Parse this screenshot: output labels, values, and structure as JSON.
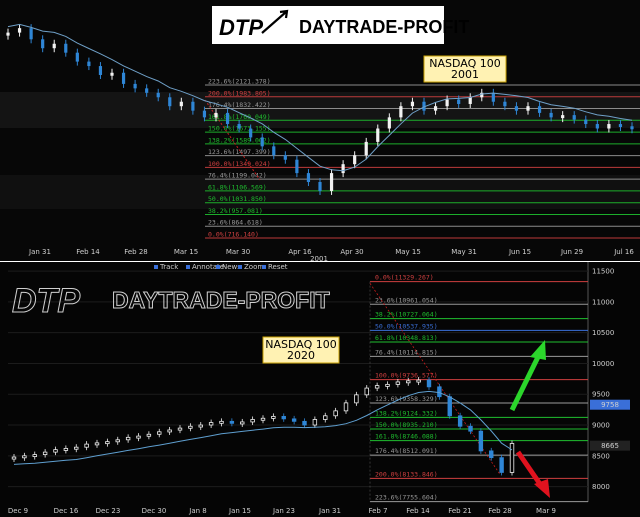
{
  "brand": {
    "top_logo": "DTP",
    "top_name": "DAYTRADE-PROFIT",
    "bottom_logo": "DTP",
    "bottom_name": "DAYTRADE-PROFIT"
  },
  "colors": {
    "background": "#000000",
    "up_candle": "#f2f2f2",
    "down_candle": "#2f86d6",
    "resistance_line": "#c81e1e",
    "fib_line": "#1fbf2f",
    "blue_line": "#3a6fd8",
    "annotation_box": "#fff2b3",
    "green_arrow": "#2bd62b",
    "red_arrow": "#e0121e"
  },
  "chart_data": [
    {
      "type": "candlestick",
      "title": "NASDAQ 100\n2001",
      "x_tick_labels": [
        "Jan 31",
        "Feb 14",
        "Feb 28",
        "Mar 15",
        "Mar 30",
        "Apr 16",
        "Apr 30",
        "May 15",
        "May 31",
        "Jun 15",
        "Jun 29",
        "Jul 16"
      ],
      "x_year_label": "2001",
      "fib_levels": [
        {
          "label": "223.6%(2121.378)",
          "color": "#9a9a9a"
        },
        {
          "label": "200.0%(1983.805)",
          "color": "#d04040"
        },
        {
          "label": "176.4%(1832.422)",
          "color": "#9a9a9a"
        },
        {
          "label": "161.8%(1760.049)",
          "color": "#1fbf2f"
        },
        {
          "label": "150.0%(1673.155)",
          "color": "#1fbf2f"
        },
        {
          "label": "138.2%(1589.002)",
          "color": "#1fbf2f"
        },
        {
          "label": "123.6%(1497.399)",
          "color": "#9a9a9a"
        },
        {
          "label": "100.0%(1349.024)",
          "color": "#d04040"
        },
        {
          "label": "76.4%(1199.042)",
          "color": "#9a9a9a"
        },
        {
          "label": "61.8%(1106.569)",
          "color": "#1fbf2f"
        },
        {
          "label": "50.0%(1031.850)",
          "color": "#1fbf2f"
        },
        {
          "label": "38.2%(957.081)",
          "color": "#1fbf2f"
        },
        {
          "label": "23.6%(864.618)",
          "color": "#9a9a9a"
        },
        {
          "label": "0.0%(716.140)",
          "color": "#d04040"
        }
      ],
      "price_path": [
        0.93,
        0.95,
        0.9,
        0.86,
        0.88,
        0.84,
        0.8,
        0.78,
        0.74,
        0.75,
        0.7,
        0.68,
        0.66,
        0.64,
        0.6,
        0.62,
        0.58,
        0.55,
        0.57,
        0.52,
        0.5,
        0.46,
        0.42,
        0.38,
        0.36,
        0.3,
        0.26,
        0.22,
        0.3,
        0.34,
        0.38,
        0.44,
        0.5,
        0.55,
        0.6,
        0.62,
        0.58,
        0.6,
        0.63,
        0.61,
        0.64,
        0.66,
        0.62,
        0.6,
        0.58,
        0.6,
        0.57,
        0.55,
        0.56,
        0.54,
        0.52,
        0.5,
        0.52,
        0.51,
        0.5
      ]
    },
    {
      "type": "candlestick",
      "title": "NASDAQ 100\n2020",
      "legend": [
        "Track",
        "Annotate",
        "News",
        "Zoom",
        "Reset"
      ],
      "x_tick_labels": [
        "Dec 9",
        "Dec 16",
        "Dec 23",
        "Dec 30",
        "Jan 8",
        "Jan 15",
        "Jan 23",
        "Jan 31",
        "Feb 7",
        "Feb 14",
        "Feb 21",
        "Feb 28",
        "Mar 9"
      ],
      "y_tick_labels": [
        "11500",
        "11000",
        "10500",
        "10000",
        "9500",
        "9000",
        "8500",
        "8000"
      ],
      "ylim": [
        7750,
        11550
      ],
      "current_price_tags": [
        "9758",
        "8665"
      ],
      "fib_levels": [
        {
          "label": "0.0%(11329.267)",
          "value": 11329,
          "color": "#d04040"
        },
        {
          "label": "23.6%(10961.054)",
          "value": 10961,
          "color": "#9a9a9a"
        },
        {
          "label": "38.2%(10727.064)",
          "value": 10727,
          "color": "#1fbf2f"
        },
        {
          "label": "50.0%(10537.935)",
          "value": 10538,
          "color": "#3a6fd8"
        },
        {
          "label": "61.8%(10348.813)",
          "value": 10349,
          "color": "#1fbf2f"
        },
        {
          "label": "76.4%(10114.815)",
          "value": 10115,
          "color": "#9a9a9a"
        },
        {
          "label": "100.0%(9736.577)",
          "value": 9737,
          "color": "#d04040"
        },
        {
          "label": "123.6%(9358.329)",
          "value": 9358,
          "color": "#9a9a9a"
        },
        {
          "label": "138.2%(9124.332)",
          "value": 9124,
          "color": "#1fbf2f"
        },
        {
          "label": "150.0%(8935.210)",
          "value": 8935,
          "color": "#1fbf2f"
        },
        {
          "label": "161.8%(8746.088)",
          "value": 8746,
          "color": "#1fbf2f"
        },
        {
          "label": "176.4%(8512.091)",
          "value": 8512,
          "color": "#9a9a9a"
        },
        {
          "label": "200.0%(8133.846)",
          "value": 8134,
          "color": "#d04040"
        },
        {
          "label": "223.6%(7755.604)",
          "value": 7756,
          "color": "#9a9a9a"
        }
      ],
      "closes": [
        8480,
        8500,
        8520,
        8560,
        8600,
        8620,
        8640,
        8690,
        8710,
        8730,
        8760,
        8800,
        8820,
        8850,
        8890,
        8920,
        8950,
        8980,
        9000,
        9040,
        9060,
        9030,
        9050,
        9090,
        9110,
        9140,
        9100,
        9060,
        9000,
        9090,
        9150,
        9230,
        9360,
        9490,
        9600,
        9640,
        9660,
        9700,
        9718,
        9730,
        9620,
        9460,
        9150,
        8980,
        8900,
        8580,
        8470,
        8230,
        8700
      ]
    }
  ]
}
